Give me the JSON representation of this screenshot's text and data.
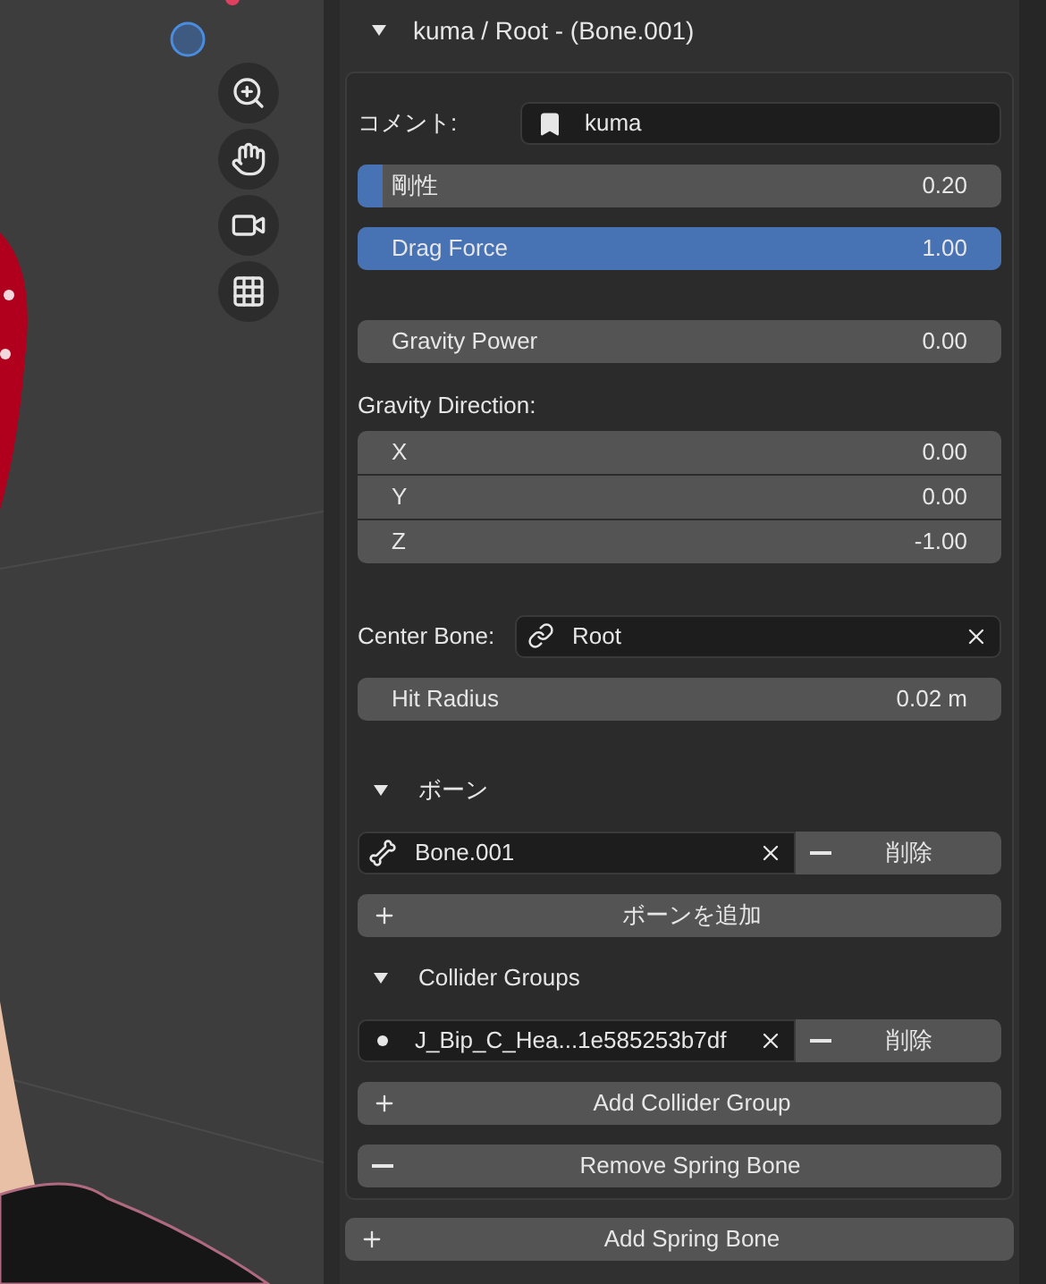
{
  "panel": {
    "title": "kuma / Root - (Bone.001)",
    "expanded": true
  },
  "comment": {
    "label": "コメント:",
    "value": "kuma"
  },
  "sliders": [
    {
      "label": "剛性",
      "value": "0.20",
      "level": 0.04
    },
    {
      "label": "Drag Force",
      "value": "1.00",
      "level": 1
    }
  ],
  "gravity_power": {
    "label": "Gravity Power",
    "value": "0.00"
  },
  "gravity_direction": {
    "label": "Gravity Direction:",
    "axes": [
      {
        "label": "X",
        "value": "0.00"
      },
      {
        "label": "Y",
        "value": "0.00"
      },
      {
        "label": "Z",
        "value": "-1.00"
      }
    ]
  },
  "center_bone": {
    "label": "Center Bone:",
    "value": "Root"
  },
  "hit_radius": {
    "label": "Hit Radius",
    "value": "0.02 m"
  },
  "sections": [
    {
      "title": "ボーン",
      "expanded": true,
      "items": [
        {
          "name": "Bone.001",
          "kind": "bone",
          "remove": "削除"
        }
      ],
      "add_button": "ボーンを追加"
    },
    {
      "title": "Collider Groups",
      "expanded": true,
      "items": [
        {
          "name": "J_Bip_C_Hea...1e585253b7df",
          "kind": "collider",
          "remove": "削除"
        }
      ],
      "add_button": "Add Collider Group"
    }
  ],
  "remove_button": "Remove Spring Bone",
  "add_spring_bone": "Add Spring Bone"
}
